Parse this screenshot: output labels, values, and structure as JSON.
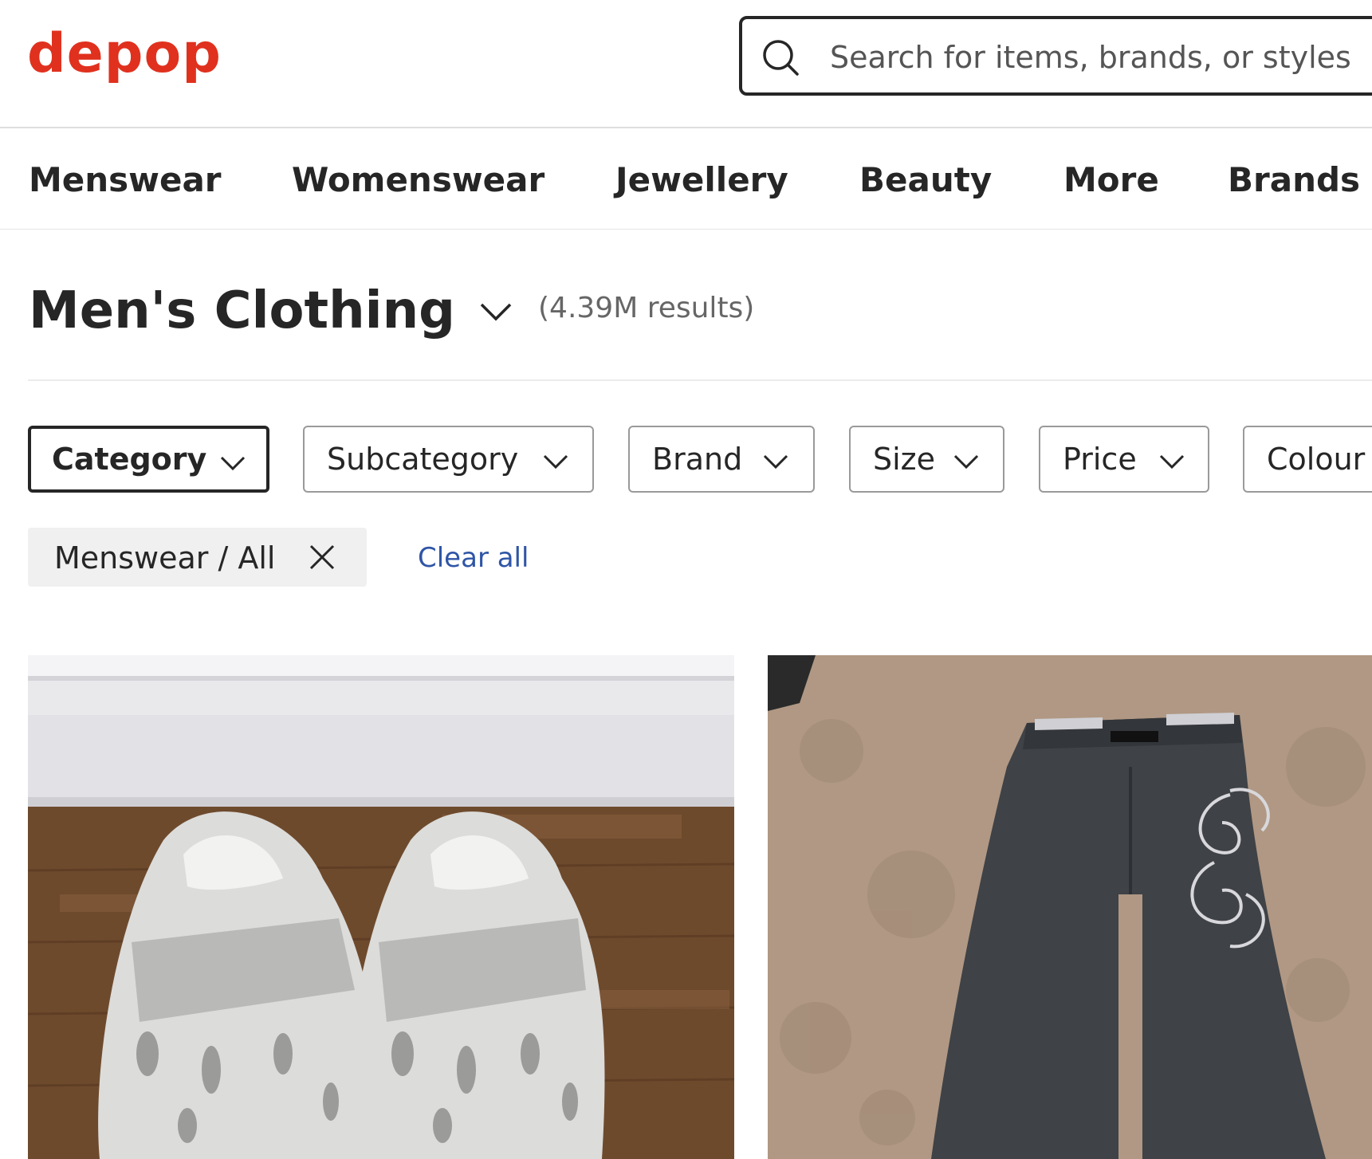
{
  "header": {
    "logo": "depop",
    "search_placeholder": "Search for items, brands, or styles"
  },
  "nav": {
    "items": [
      "Menswear",
      "Womenswear",
      "Jewellery",
      "Beauty",
      "More",
      "Brands"
    ]
  },
  "page": {
    "title": "Men's Clothing",
    "results": "(4.39M results)"
  },
  "filters": [
    "Category",
    "Subcategory",
    "Brand",
    "Size",
    "Price",
    "Colour"
  ],
  "active_filter": "Category",
  "applied": {
    "chip_label": "Menswear / All",
    "clear_all": "Clear all"
  },
  "products": [
    {
      "image": "white-crocs-clogs-photo"
    },
    {
      "image": "dark-embroidered-jeans-photo"
    }
  ],
  "colors": {
    "brand": "#e0311e",
    "link": "#2f55a6",
    "text": "#262626"
  }
}
